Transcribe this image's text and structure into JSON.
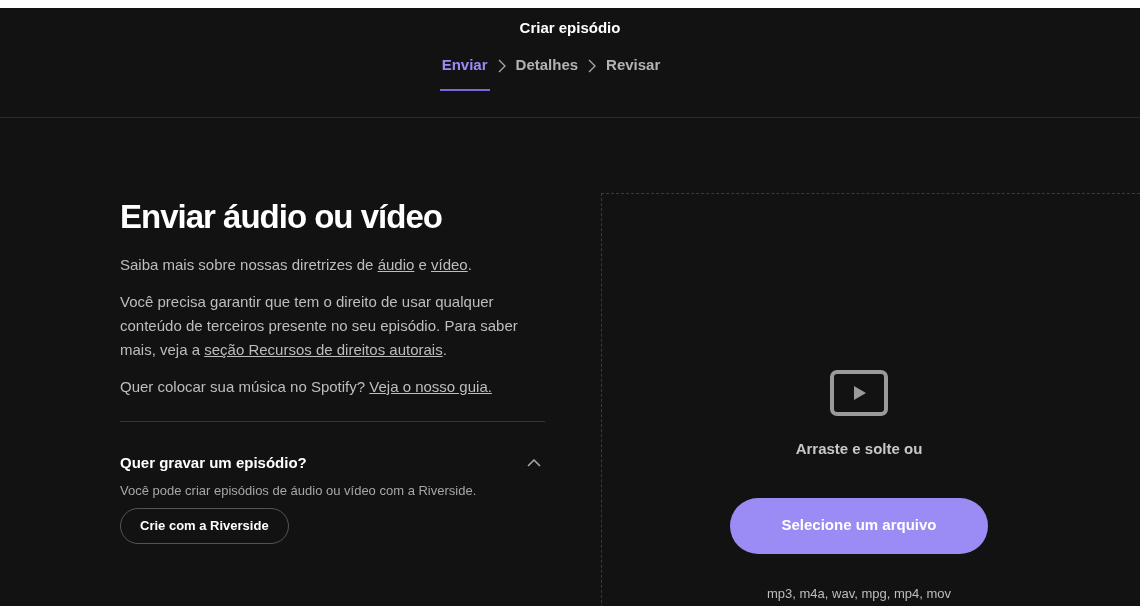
{
  "header": {
    "title": "Criar episódio",
    "steps": [
      {
        "label": "Enviar",
        "selected": true
      },
      {
        "label": "Detalhes",
        "selected": false
      },
      {
        "label": "Revisar",
        "selected": false
      }
    ]
  },
  "heading": "Enviar áudio ou vídeo",
  "paragraphs": [
    [
      {
        "kind": "text",
        "text": "Saiba mais sobre nossas diretrizes de "
      },
      {
        "kind": "link",
        "text": "áudio"
      },
      {
        "kind": "text",
        "text": " e "
      },
      {
        "kind": "link",
        "text": "vídeo"
      },
      {
        "kind": "text",
        "text": "."
      }
    ],
    [
      {
        "kind": "text",
        "text": "Você precisa garantir que tem o direito de usar qualquer conteúdo de terceiros presente no seu episódio. Para saber mais, veja a "
      },
      {
        "kind": "link",
        "text": "seção Recursos de direitos autorais"
      },
      {
        "kind": "text",
        "text": "."
      }
    ],
    [
      {
        "kind": "text",
        "text": "Quer colocar sua música no Spotify? "
      },
      {
        "kind": "link",
        "text": "Veja o nosso guia."
      }
    ]
  ],
  "record": {
    "title": "Quer gravar um episódio?",
    "expanded": true,
    "description": "Você pode criar episódios de áudio ou vídeo com a Riverside.",
    "button": "Crie com a Riverside"
  },
  "dropzone": {
    "prompt": "Arraste e solte ou",
    "button": "Selecione um arquivo",
    "formats": "mp3, m4a, wav, mpg, mp4, mov"
  }
}
